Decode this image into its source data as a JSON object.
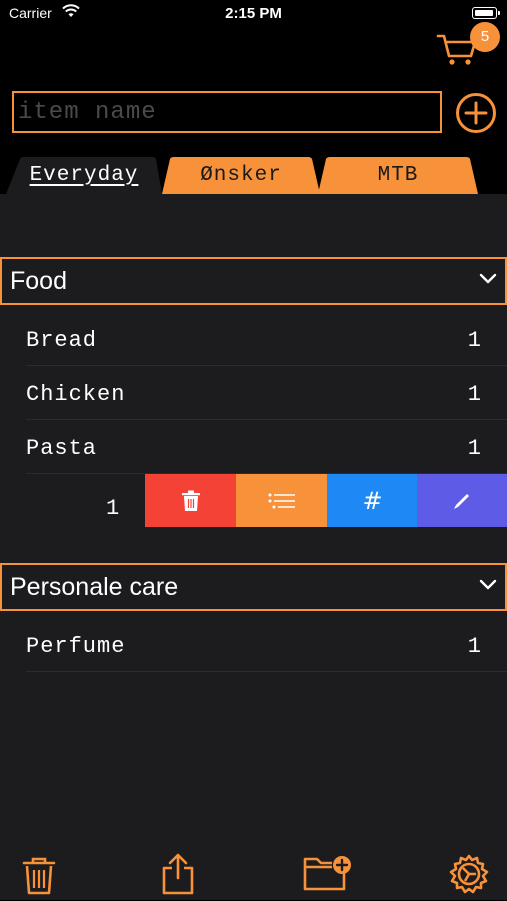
{
  "status_bar": {
    "carrier": "Carrier",
    "time": "2:15 PM"
  },
  "cart": {
    "count": "5"
  },
  "search": {
    "placeholder": "item name"
  },
  "tabs": [
    {
      "label": "Everyday",
      "active": true
    },
    {
      "label": "Ønsker",
      "active": false
    },
    {
      "label": "MTB",
      "active": false
    }
  ],
  "sections": [
    {
      "title": "Personale care",
      "items": [
        {
          "name": "Perfume",
          "qty": "1"
        }
      ]
    },
    {
      "title": "Food",
      "items": [
        {
          "name": "Bread",
          "qty": "1"
        },
        {
          "name": "Chicken",
          "qty": "1"
        },
        {
          "name": "Pasta",
          "qty": "1"
        }
      ],
      "swiped_item": {
        "qty": "1"
      }
    }
  ],
  "swipe_actions": {
    "hash_label": "#"
  },
  "colors": {
    "accent": "#f7923a",
    "background": "#1c1c1e",
    "delete": "#f44336",
    "blue": "#1e88f5",
    "purple": "#5e5ce6"
  },
  "toolbar": {
    "icons": [
      "trash-icon",
      "share-icon",
      "new-folder-icon",
      "settings-icon"
    ]
  }
}
